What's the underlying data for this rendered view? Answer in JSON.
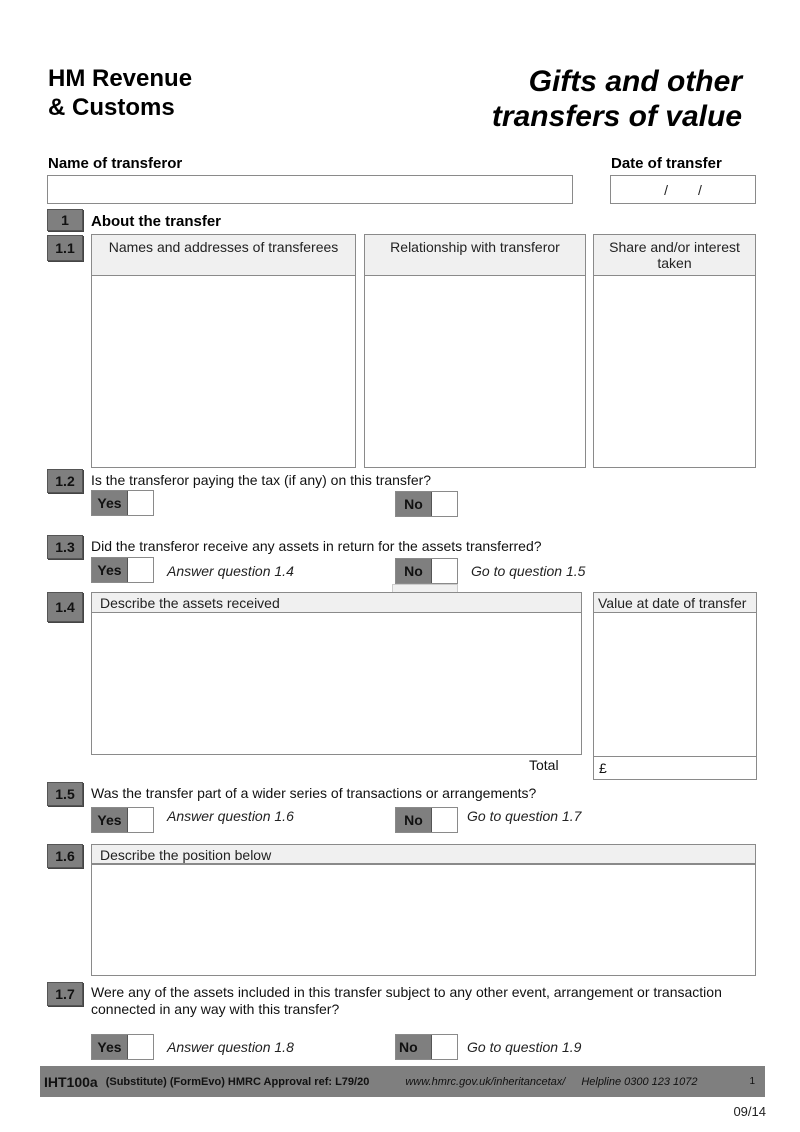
{
  "header": {
    "org_line1": "HM Revenue",
    "org_line2": "& Customs",
    "title_line1": "Gifts and other",
    "title_line2": "transfers of value"
  },
  "top_fields": {
    "name_label": "Name of transferor",
    "name_value": "",
    "date_label": "Date of transfer",
    "date_sep1": "/",
    "date_sep2": "/"
  },
  "section1": {
    "number": "1",
    "title": "About the transfer"
  },
  "q1_1": {
    "number": "1.1",
    "columns": [
      "Names and addresses of transferees",
      "Relationship with transferor",
      "Share and/or interest taken"
    ]
  },
  "q1_2": {
    "number": "1.2",
    "text": "Is the transferor paying the tax (if any) on this transfer?",
    "yes": "Yes",
    "no": "No"
  },
  "q1_3": {
    "number": "1.3",
    "text": "Did the transferor receive any assets in return for the assets transferred?",
    "yes": "Yes",
    "yes_hint": "Answer question 1.4",
    "no": "No",
    "no_hint": "Go to question 1.5"
  },
  "q1_4": {
    "number": "1.4",
    "describe_header": "Describe the assets received",
    "value_header": "Value at date of transfer",
    "total_label": "Total",
    "currency": "£"
  },
  "q1_5": {
    "number": "1.5",
    "text": "Was the transfer part of a wider series of transactions or arrangements?",
    "yes": "Yes",
    "yes_hint": "Answer question 1.6",
    "no": "No",
    "no_hint": "Go to question 1.7"
  },
  "q1_6": {
    "number": "1.6",
    "describe_header": "Describe the position below"
  },
  "q1_7": {
    "number": "1.7",
    "text_line1": "Were any of the assets included in this transfer subject to any other event, arrangement or transaction",
    "text_line2": "connected in any way with this transfer?",
    "yes": "Yes",
    "yes_hint": "Answer question 1.8",
    "no": "No",
    "no_hint": "Go to question 1.9"
  },
  "footer": {
    "form_code": "IHT100a",
    "approval": "(Substitute) (FormEvo) HMRC Approval ref: L79/20",
    "url": "www.hmrc.gov.uk/inheritancetax/",
    "helpline": "Helpline 0300 123 1072",
    "page": "1",
    "version": "09/14"
  }
}
